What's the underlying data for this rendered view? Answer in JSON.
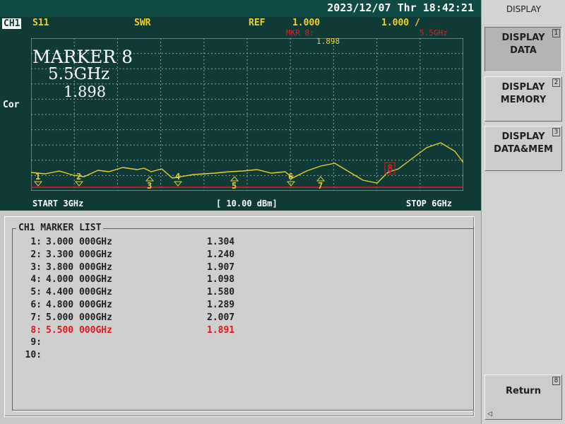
{
  "datetime": "2023/12/07 Thr 18:42:21",
  "channel": "CH1",
  "param": "S11",
  "format": "SWR",
  "ref_label": "REF",
  "ref_value": "1.000",
  "scale": "1.000 /",
  "mkr_label": "MKR 8:",
  "mkr_freq": "5.5GHz",
  "mkr_value": "1.898",
  "correction": "Cor",
  "marker_title": "MARKER 8",
  "marker_freq": "5.5GHz",
  "marker_value": "1.898",
  "start": "START 3GHz",
  "power": "[ 10.00 dBm]",
  "stop": "STOP 6GHz",
  "list_title": "CH1 MARKER LIST",
  "rows": [
    {
      "num": "1:",
      "freq": "3.000 000GHz",
      "val": "1.304"
    },
    {
      "num": "2:",
      "freq": "3.300 000GHz",
      "val": "1.240"
    },
    {
      "num": "3:",
      "freq": "3.800 000GHz",
      "val": "1.907"
    },
    {
      "num": "4:",
      "freq": "4.000 000GHz",
      "val": "1.098"
    },
    {
      "num": "5:",
      "freq": "4.400 000GHz",
      "val": "1.580"
    },
    {
      "num": "6:",
      "freq": "4.800 000GHz",
      "val": "1.289"
    },
    {
      "num": "7:",
      "freq": "5.000 000GHz",
      "val": "2.007"
    },
    {
      "num": "8:",
      "freq": "5.500 000GHz",
      "val": "1.891"
    },
    {
      "num": "9:",
      "freq": "",
      "val": ""
    },
    {
      "num": "10:",
      "freq": "",
      "val": ""
    }
  ],
  "active_row": 7,
  "softkeys": {
    "title": "DISPLAY",
    "b1": {
      "line1": "DISPLAY",
      "line2": "DATA",
      "key": "1"
    },
    "b2": {
      "line1": "DISPLAY",
      "line2": "MEMORY",
      "key": "2"
    },
    "b3": {
      "line1": "DISPLAY",
      "line2": "DATA&MEM",
      "key": "3"
    },
    "ret": {
      "label": "Return",
      "key": "8"
    }
  },
  "colors": {
    "trace": "#e6d030",
    "grid": "#7f9a95",
    "bg": "#103a35",
    "marker_active": "#e02020"
  },
  "markers": [
    "1",
    "2",
    "3",
    "4",
    "5",
    "6",
    "7",
    "8"
  ]
}
